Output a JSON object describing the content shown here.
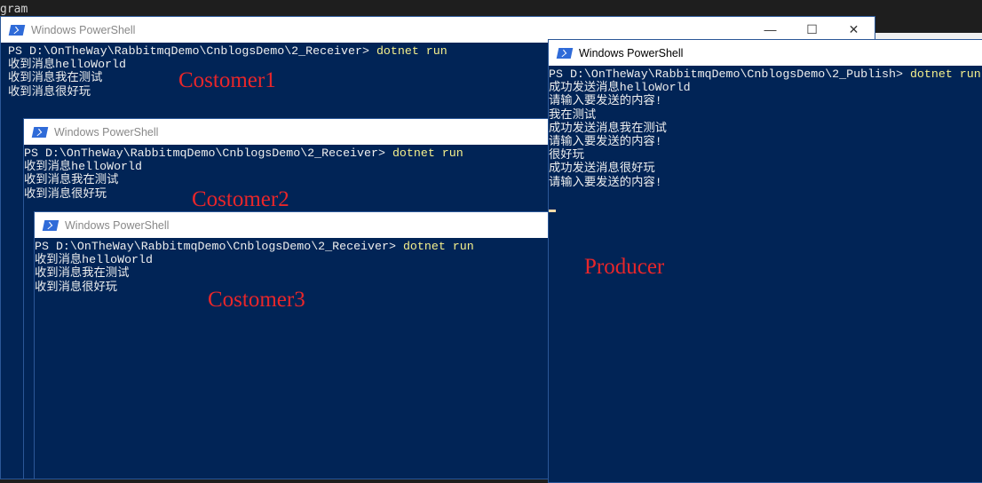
{
  "background_code": [
    "gram"
  ],
  "windows": [
    {
      "title": "Windows PowerShell",
      "prompt": "PS D:\\OnTheWay\\RabbitmqDemo\\CnblogsDemo\\2_Receiver> ",
      "command": "dotnet run",
      "lines": [
        "收到消息helloWorld",
        "收到消息我在测试",
        "收到消息很好玩"
      ],
      "label": "Costomer1"
    },
    {
      "title": "Windows PowerShell",
      "prompt": "PS D:\\OnTheWay\\RabbitmqDemo\\CnblogsDemo\\2_Receiver> ",
      "command": "dotnet run",
      "lines": [
        "收到消息helloWorld",
        "收到消息我在测试",
        "收到消息很好玩"
      ],
      "label": "Costomer2"
    },
    {
      "title": "Windows PowerShell",
      "prompt": "PS D:\\OnTheWay\\RabbitmqDemo\\CnblogsDemo\\2_Receiver> ",
      "command": "dotnet run",
      "lines": [
        "收到消息helloWorld",
        "收到消息我在测试",
        "收到消息很好玩"
      ],
      "label": "Costomer3"
    },
    {
      "title": "Windows PowerShell",
      "prompt": "PS D:\\OnTheWay\\RabbitmqDemo\\CnblogsDemo\\2_Publish> ",
      "command": "dotnet run",
      "lines": [
        "成功发送消息helloWorld",
        "请输入要发送的内容!",
        "我在测试",
        "成功发送消息我在测试",
        "请输入要发送的内容!",
        "很好玩",
        "成功发送消息很好玩",
        "请输入要发送的内容!"
      ],
      "label": "Producer"
    }
  ],
  "controls": {
    "minimize": "—",
    "maximize": "☐",
    "close": "✕"
  }
}
